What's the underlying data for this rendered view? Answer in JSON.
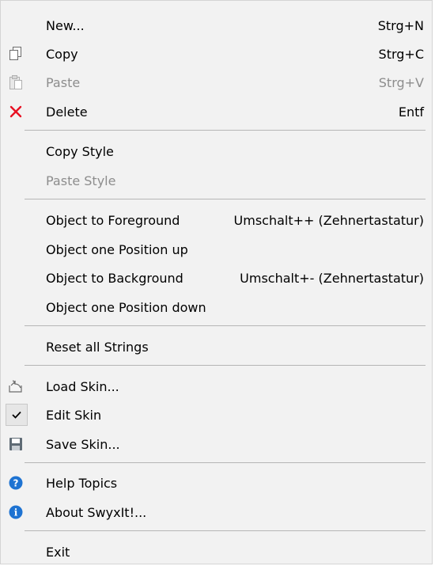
{
  "menu": {
    "items": [
      {
        "label": "New...",
        "shortcut": "Strg+N"
      },
      {
        "label": "Copy",
        "shortcut": "Strg+C",
        "icon": "copy-icon"
      },
      {
        "label": "Paste",
        "shortcut": "Strg+V",
        "icon": "paste-icon",
        "disabled": true
      },
      {
        "label": "Delete",
        "shortcut": "Entf",
        "icon": "delete-x-icon"
      },
      {
        "label": "Copy Style"
      },
      {
        "label": "Paste Style",
        "disabled": true
      },
      {
        "label": "Object to Foreground",
        "shortcut": "Umschalt++ (Zehnertastatur)"
      },
      {
        "label": "Object one Position up"
      },
      {
        "label": "Object to Background",
        "shortcut": "Umschalt+- (Zehnertastatur)"
      },
      {
        "label": "Object one Position down"
      },
      {
        "label": "Reset all Strings"
      },
      {
        "label": "Load Skin...",
        "icon": "load-skin-icon"
      },
      {
        "label": "Edit Skin",
        "icon": "checkmark-icon",
        "checked": true
      },
      {
        "label": "Save Skin...",
        "icon": "save-icon"
      },
      {
        "label": "Help Topics",
        "icon": "help-icon"
      },
      {
        "label": "About SwyxIt!...",
        "icon": "info-icon"
      },
      {
        "label": "Exit"
      }
    ]
  },
  "colors": {
    "background": "#f2f2f2",
    "disabled_text": "#8d8d8d",
    "separator": "#b6b6b6",
    "delete_red": "#e81123",
    "help_blue": "#1e73d2"
  }
}
